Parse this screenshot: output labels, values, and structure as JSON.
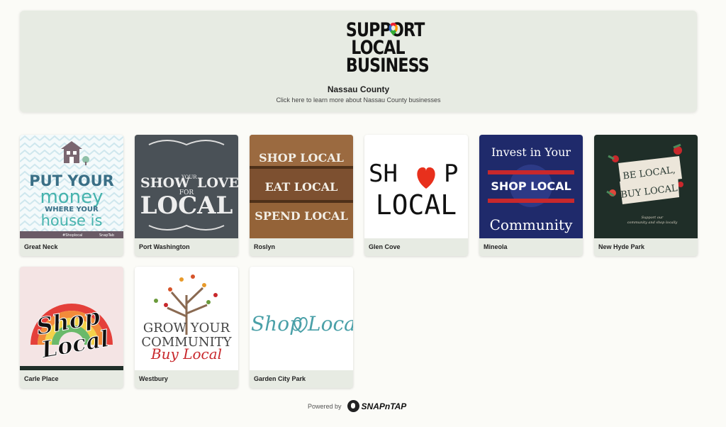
{
  "header": {
    "logo_lines": [
      "SUPPORT",
      "LOCAL",
      "BUSINESS"
    ],
    "title": "Nassau County",
    "subtitle": "Click here to learn more about Nassau County businesses"
  },
  "locations": [
    {
      "name": "Great Neck",
      "art": {
        "l1": "PUT YOUR",
        "l2": "money",
        "l3": "WHERE YOUR",
        "l4": "house is",
        "tag": "#Shoplocal",
        "brand": "SnapTab"
      }
    },
    {
      "name": "Port Washington",
      "art": {
        "l1": "SHOW",
        "l2": "YOUR",
        "l3": "LOVE",
        "l4": "FOR",
        "l5": "LOCAL"
      }
    },
    {
      "name": "Roslyn",
      "art": {
        "l1": "SHOP LOCAL",
        "l2": "EAT LOCAL",
        "l3": "SPEND LOCAL"
      }
    },
    {
      "name": "Glen Cove",
      "art": {
        "l1": "SH",
        "l2": "P",
        "l3": "LOCAL"
      }
    },
    {
      "name": "Mineola",
      "art": {
        "l1": "Invest in Your",
        "l2": "SHOP LOCAL",
        "l3": "Community"
      }
    },
    {
      "name": "New Hyde Park",
      "art": {
        "l1": "BE LOCAL,",
        "l2": "BUY LOCAL",
        "l3": "Support our",
        "l4": "community and shop locally"
      }
    },
    {
      "name": "Carle Place",
      "art": {
        "l1": "Shop",
        "l2": "Local"
      }
    },
    {
      "name": "Westbury",
      "art": {
        "l1": "GROW YOUR",
        "l2": "COMMUNITY",
        "l3": "Buy Local"
      }
    },
    {
      "name": "Garden City Park",
      "art": {
        "l1": "Shop",
        "l2": "Local"
      }
    }
  ],
  "footer": {
    "powered_by": "Powered by",
    "brand": "SNAPnTAP"
  },
  "colors": {
    "page_bg": "#fbfbf7",
    "card_bg": "#e7ebe3",
    "mineola_red": "#c8282c",
    "mineola_navy": "#1f2a6b",
    "heart_red": "#e8301c"
  }
}
